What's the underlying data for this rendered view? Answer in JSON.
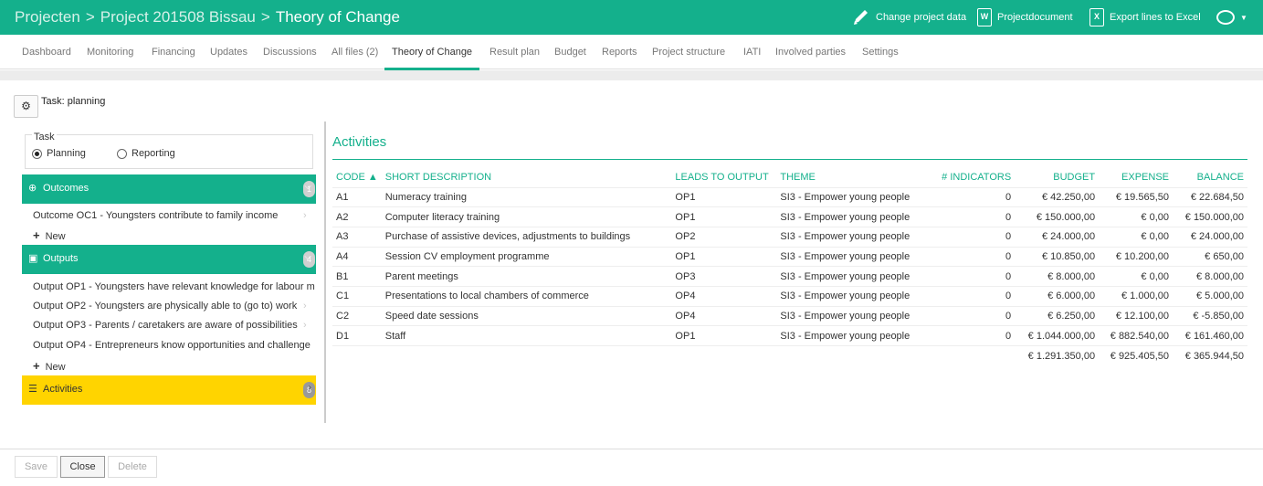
{
  "header": {
    "crumbs": [
      "Projecten",
      "Project 201508 Bissau",
      "Theory of Change"
    ],
    "actions": {
      "change": "Change project data",
      "document": "Projectdocument",
      "document_icon_letter": "W",
      "export": "Export lines to Excel",
      "export_icon_letter": "X"
    },
    "accent_color": "#14b08c"
  },
  "tabs": [
    "Dashboard",
    "Monitoring",
    "Financing",
    "Updates",
    "Discussions",
    "All files (2)",
    "Theory of Change",
    "Result plan",
    "Budget",
    "Reports",
    "Project structure",
    "IATI",
    "Involved parties",
    "Settings"
  ],
  "active_tab": "Theory of Change",
  "task": {
    "title": "Task: planning",
    "legend": "Task",
    "options": [
      "Planning",
      "Reporting"
    ],
    "selected": "Planning"
  },
  "outcomes": {
    "title": "Outcomes",
    "count": "1",
    "items": [
      "Outcome OC1 - Youngsters contribute to family income"
    ],
    "new_label": "New"
  },
  "outputs": {
    "title": "Outputs",
    "count": "4",
    "items": [
      "Output OP1 - Youngsters have relevant knowledge for labour m",
      "Output OP2 - Youngsters are physically able to (go to) work",
      "Output OP3 - Parents / caretakers are aware of possibilities",
      "Output OP4 - Entrepreneurs know opportunities and challenge"
    ],
    "new_label": "New"
  },
  "activities_section": {
    "title": "Activities",
    "count": "8"
  },
  "activities": {
    "title": "Activities",
    "columns": [
      "CODE ▲",
      "SHORT DESCRIPTION",
      "LEADS TO OUTPUT",
      "THEME",
      "# INDICATORS",
      "BUDGET",
      "EXPENSE",
      "BALANCE"
    ],
    "rows": [
      [
        "A1",
        "Numeracy training",
        "OP1",
        "SI3 - Empower young people",
        "0",
        "€ 42.250,00",
        "€ 19.565,50",
        "€ 22.684,50"
      ],
      [
        "A2",
        "Computer literacy training",
        "OP1",
        "SI3 - Empower young people",
        "0",
        "€ 150.000,00",
        "€ 0,00",
        "€ 150.000,00"
      ],
      [
        "A3",
        "Purchase of assistive devices, adjustments to buildings",
        "OP2",
        "SI3 - Empower young people",
        "0",
        "€ 24.000,00",
        "€ 0,00",
        "€ 24.000,00"
      ],
      [
        "A4",
        "Session CV employment programme",
        "OP1",
        "SI3 - Empower young people",
        "0",
        "€ 10.850,00",
        "€ 10.200,00",
        "€ 650,00"
      ],
      [
        "B1",
        "Parent meetings",
        "OP3",
        "SI3 - Empower young people",
        "0",
        "€ 8.000,00",
        "€ 0,00",
        "€ 8.000,00"
      ],
      [
        "C1",
        "Presentations to local chambers of commerce",
        "OP4",
        "SI3 - Empower young people",
        "0",
        "€ 6.000,00",
        "€ 1.000,00",
        "€ 5.000,00"
      ],
      [
        "C2",
        "Speed date sessions",
        "OP4",
        "SI3 - Empower young people",
        "0",
        "€ 6.250,00",
        "€ 12.100,00",
        "€ -5.850,00"
      ],
      [
        "D1",
        "Staff",
        "OP1",
        "SI3 - Empower young people",
        "0",
        "€ 1.044.000,00",
        "€ 882.540,00",
        "€ 161.460,00"
      ]
    ],
    "totals": [
      "€ 1.291.350,00",
      "€ 925.405,50",
      "€ 365.944,50"
    ]
  },
  "footer": {
    "save": "Save",
    "close": "Close",
    "delete": "Delete"
  }
}
